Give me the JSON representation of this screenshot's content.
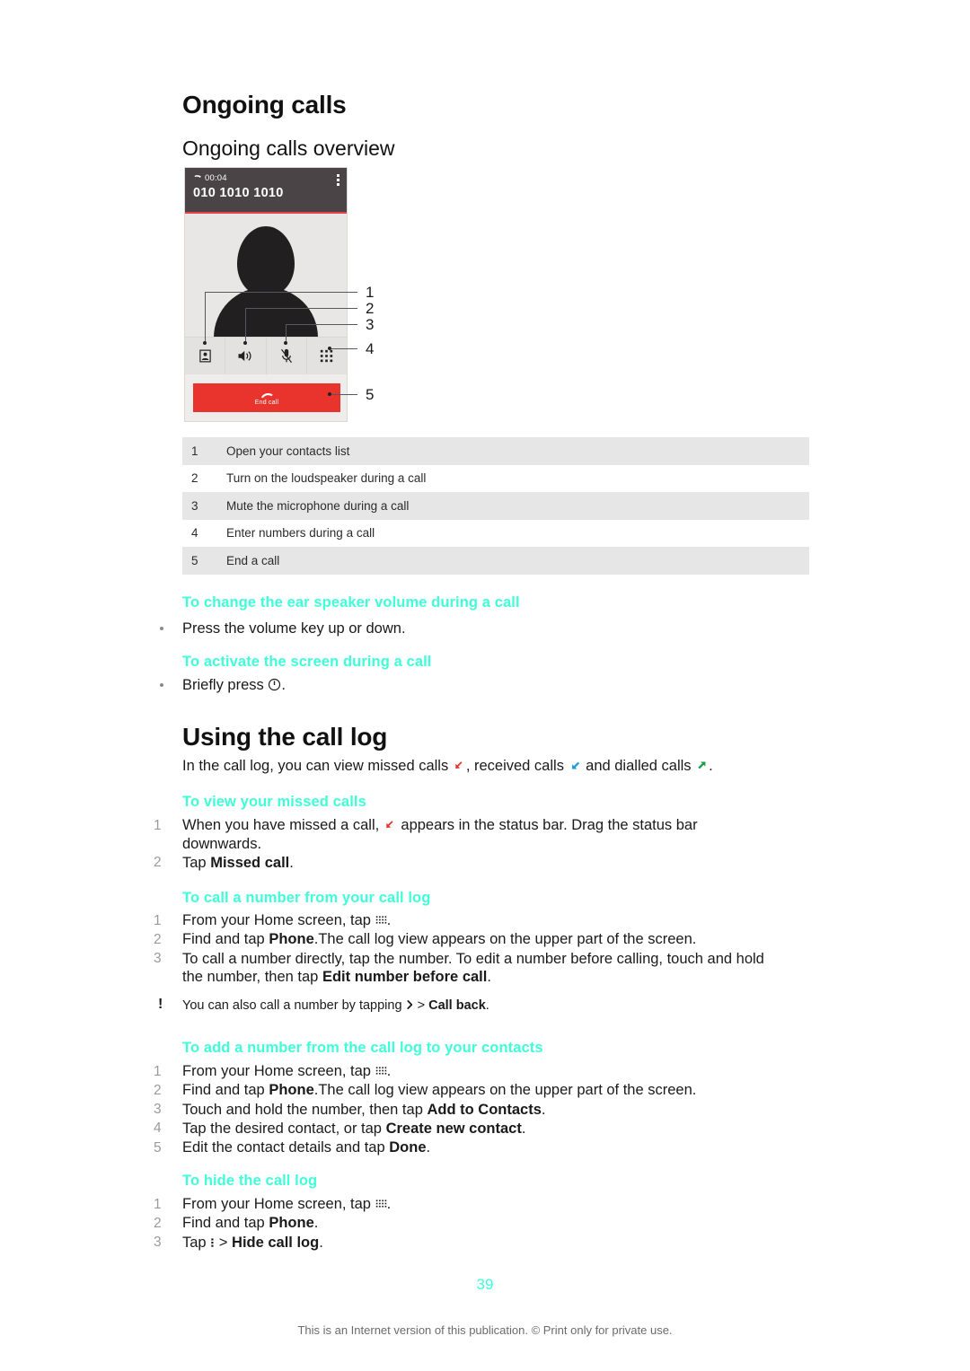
{
  "document": {
    "title": "Ongoing calls",
    "section_overview_title": "Ongoing calls overview",
    "section_calllog_title": "Using the call log",
    "page_number": "39",
    "footnote": "This is an Internet version of this publication. © Print only for private use."
  },
  "phone_mockup": {
    "timer": "00:04",
    "number": "010 1010 1010",
    "end_call_label": "End call",
    "icons": {
      "handset": "phone-handset-icon",
      "overflow": "overflow-menu-icon",
      "contacts": "contacts-icon",
      "loudspeaker": "loudspeaker-icon",
      "mute": "mute-microphone-icon",
      "keypad": "keypad-icon",
      "end_call": "end-call-icon"
    },
    "callouts": [
      "1",
      "2",
      "3",
      "4",
      "5"
    ]
  },
  "overview_table": {
    "rows": [
      {
        "num": "1",
        "text": "Open your contacts list"
      },
      {
        "num": "2",
        "text": "Turn on the loudspeaker during a call"
      },
      {
        "num": "3",
        "text": "Mute the microphone during a call"
      },
      {
        "num": "4",
        "text": "Enter numbers during a call"
      },
      {
        "num": "5",
        "text": "End a call"
      }
    ]
  },
  "proc_volume": {
    "heading": "To change the ear speaker volume during a call",
    "bullet": "Press the volume key up or down."
  },
  "proc_activate": {
    "heading": "To activate the screen during a call",
    "bullet_prefix": "Briefly press",
    "bullet_suffix": "."
  },
  "calllog_intro": {
    "part1": "In the call log, you can view missed calls",
    "part2": ", received calls",
    "part3": "and dialled calls",
    "part4": "."
  },
  "proc_missed": {
    "heading": "To view your missed calls",
    "step1_a": "When you have missed a call,",
    "step1_b": "appears in the status bar. Drag the status bar downwards.",
    "step2_a": "Tap",
    "step2_b": "Missed call",
    "step2_c": "."
  },
  "proc_call_number": {
    "heading": "To call a number from your call log",
    "step1_a": "From your Home screen, tap",
    "step1_b": ".",
    "step2_a": "Find and tap",
    "step2_b": "Phone",
    "step2_c": ".The call log view appears on the upper part of the screen.",
    "step3_a": "To call a number directly, tap the number. To edit a number before calling, touch and hold the number, then tap",
    "step3_b": "Edit number before call",
    "step3_c": ".",
    "tip_a": "You can also call a number by tapping",
    "tip_b": ">",
    "tip_c": "Call back",
    "tip_d": "."
  },
  "proc_add_number": {
    "heading": "To add a number from the call log to your contacts",
    "step1_a": "From your Home screen, tap",
    "step1_b": ".",
    "step2_a": "Find and tap",
    "step2_b": "Phone",
    "step2_c": ".The call log view appears on the upper part of the screen.",
    "step3_a": "Touch and hold the number, then tap",
    "step3_b": "Add to Contacts",
    "step3_c": ".",
    "step4_a": "Tap the desired contact, or tap",
    "step4_b": "Create new contact",
    "step4_c": ".",
    "step5_a": "Edit the contact details and tap",
    "step5_b": "Done",
    "step5_c": "."
  },
  "proc_hide": {
    "heading": "To hide the call log",
    "step1_a": "From your Home screen, tap",
    "step1_b": ".",
    "step2_a": "Find and tap",
    "step2_b": "Phone",
    "step2_c": ".",
    "step3_a": "Tap",
    "step3_b": ">",
    "step3_c": "Hide call log",
    "step3_d": "."
  },
  "step_numbers": {
    "n1": "1",
    "n2": "2",
    "n3": "3",
    "n4": "4",
    "n5": "5"
  },
  "colors": {
    "heading_accent": "#3FFFD8",
    "missed_call": "#E8342C",
    "received_call": "#1E9BE0",
    "dialled_call": "#1A9E4B",
    "end_call_button": "#E8342C",
    "table_shade": "#E6E6E6",
    "phone_topbar": "#4A4446"
  }
}
